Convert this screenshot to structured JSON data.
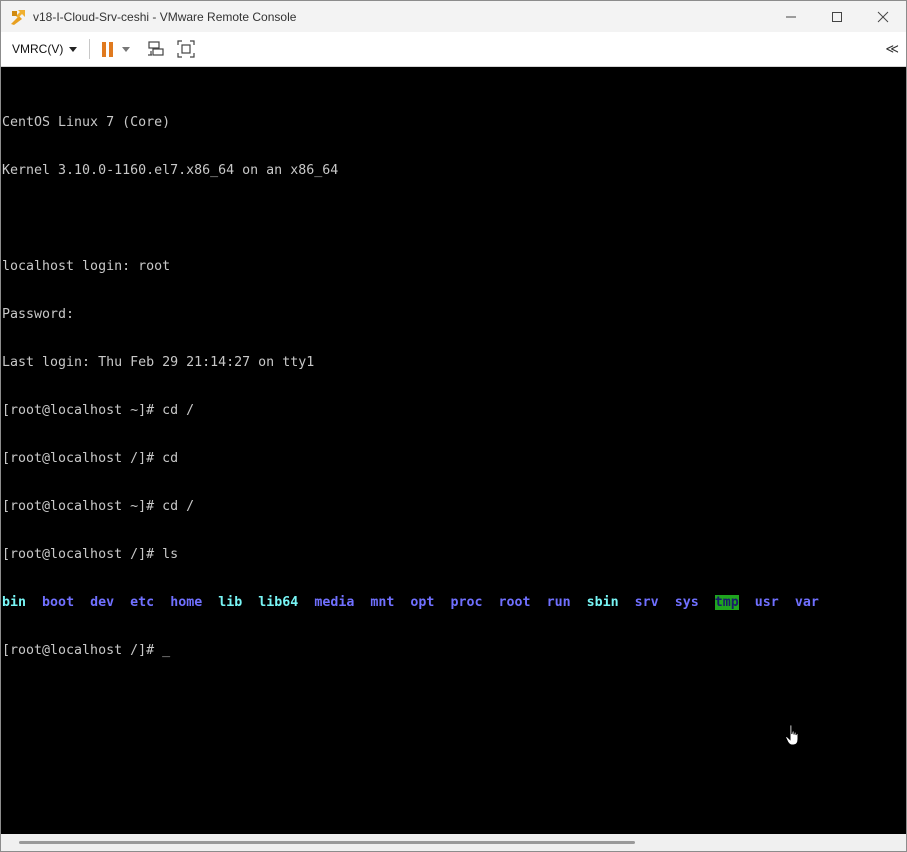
{
  "window": {
    "title": "v18-I-Cloud-Srv-ceshi - VMware Remote Console"
  },
  "toolbar": {
    "menu_label": "VMRC(V)",
    "collapse_label": "≪"
  },
  "terminal": {
    "lines": [
      "CentOS Linux 7 (Core)",
      "Kernel 3.10.0-1160.el7.x86_64 on an x86_64",
      "",
      "localhost login: root",
      "Password:",
      "Last login: Thu Feb 29 21:14:27 on tty1",
      "[root@localhost ~]# cd /",
      "[root@localhost /]# cd",
      "[root@localhost ~]# cd /",
      "[root@localhost /]# ls"
    ],
    "ls_output": [
      {
        "name": "bin",
        "color": "#78f5f5"
      },
      {
        "name": "boot",
        "color": "#7070ff"
      },
      {
        "name": "dev",
        "color": "#7070ff"
      },
      {
        "name": "etc",
        "color": "#7070ff"
      },
      {
        "name": "home",
        "color": "#7070ff"
      },
      {
        "name": "lib",
        "color": "#78f5f5"
      },
      {
        "name": "lib64",
        "color": "#78f5f5"
      },
      {
        "name": "media",
        "color": "#7070ff"
      },
      {
        "name": "mnt",
        "color": "#7070ff"
      },
      {
        "name": "opt",
        "color": "#7070ff"
      },
      {
        "name": "proc",
        "color": "#7070ff"
      },
      {
        "name": "root",
        "color": "#7070ff"
      },
      {
        "name": "run",
        "color": "#7070ff"
      },
      {
        "name": "sbin",
        "color": "#78f5f5"
      },
      {
        "name": "srv",
        "color": "#7070ff"
      },
      {
        "name": "sys",
        "color": "#7070ff"
      },
      {
        "name": "tmp",
        "color": "#1a1a6a",
        "background": "#1fa51f"
      },
      {
        "name": "usr",
        "color": "#7070ff"
      },
      {
        "name": "var",
        "color": "#7070ff"
      }
    ],
    "prompt": "[root@localhost /]# ",
    "cursor": "_"
  },
  "colors": {
    "terminal_bg": "#000000",
    "terminal_fg": "#c8c8c8",
    "pause_accent": "#e07a1f"
  },
  "icons": {
    "app": "vmware-vmrc-icon",
    "pause": "pause-icon",
    "send_keys": "send-ctrl-alt-del-icon",
    "fullscreen": "fullscreen-icon",
    "collapse": "double-chevron-left-icon",
    "minimize": "minimize-icon",
    "maximize": "maximize-icon",
    "close": "close-icon",
    "mouse": "hand-pointer-icon"
  }
}
